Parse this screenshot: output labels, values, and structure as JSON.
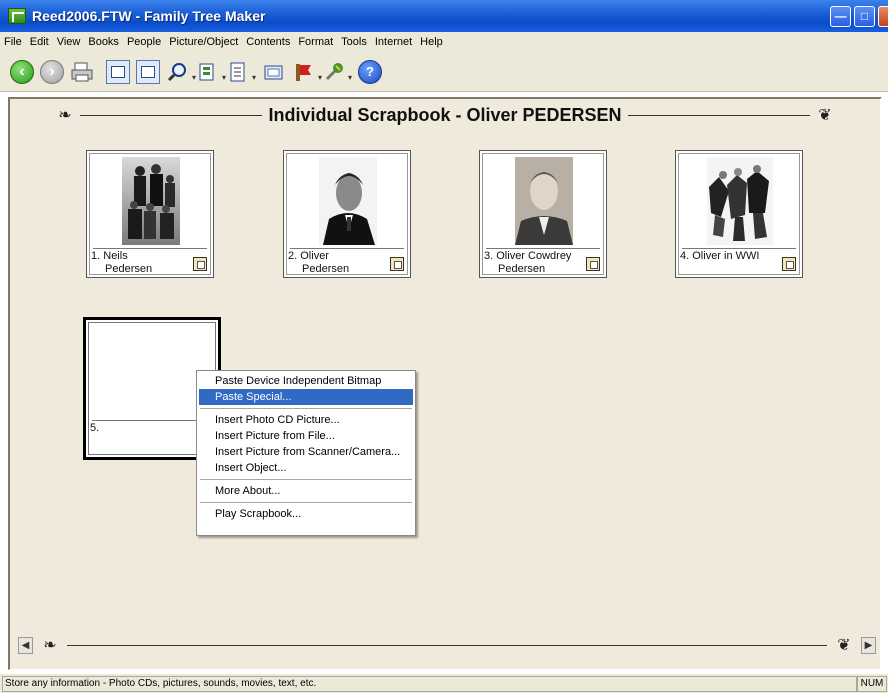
{
  "window": {
    "title": "Reed2006.FTW - Family Tree Maker"
  },
  "menu": [
    "File",
    "Edit",
    "View",
    "Books",
    "People",
    "Picture/Object",
    "Contents",
    "Format",
    "Tools",
    "Internet",
    "Help"
  ],
  "toolbar": {
    "icons": [
      "back-icon",
      "forward-icon",
      "print-icon",
      "family-page-icon",
      "tree-icon",
      "search-icon",
      "pages-icon",
      "report-icon",
      "notes-icon",
      "bookmark-icon",
      "tools-icon",
      "help-icon"
    ]
  },
  "scrapbook": {
    "title": "Individual Scrapbook - Oliver PEDERSEN",
    "items": [
      {
        "num": "1.",
        "line1": "Neils",
        "line2": "Pedersen"
      },
      {
        "num": "2.",
        "line1": "Oliver",
        "line2": "Pedersen"
      },
      {
        "num": "3.",
        "line1": "Oliver Cowdrey",
        "line2": "Pedersen"
      },
      {
        "num": "4.",
        "line1": "Oliver in WWI",
        "line2": ""
      },
      {
        "num": "5.",
        "line1": "",
        "line2": ""
      }
    ]
  },
  "context_menu": {
    "items": [
      {
        "label": "Paste Device Independent Bitmap"
      },
      {
        "label": "Paste Special..."
      },
      {
        "label": "Insert Photo CD Picture..."
      },
      {
        "label": "Insert Picture from File..."
      },
      {
        "label": "Insert Picture from Scanner/Camera..."
      },
      {
        "label": "Insert Object..."
      },
      {
        "label": "More About..."
      },
      {
        "label": "Play Scrapbook..."
      }
    ],
    "highlighted": "Paste Special..."
  },
  "status": {
    "text": "Store any information - Photo CDs, pictures, sounds, movies, text, etc.",
    "num": "NUM"
  }
}
